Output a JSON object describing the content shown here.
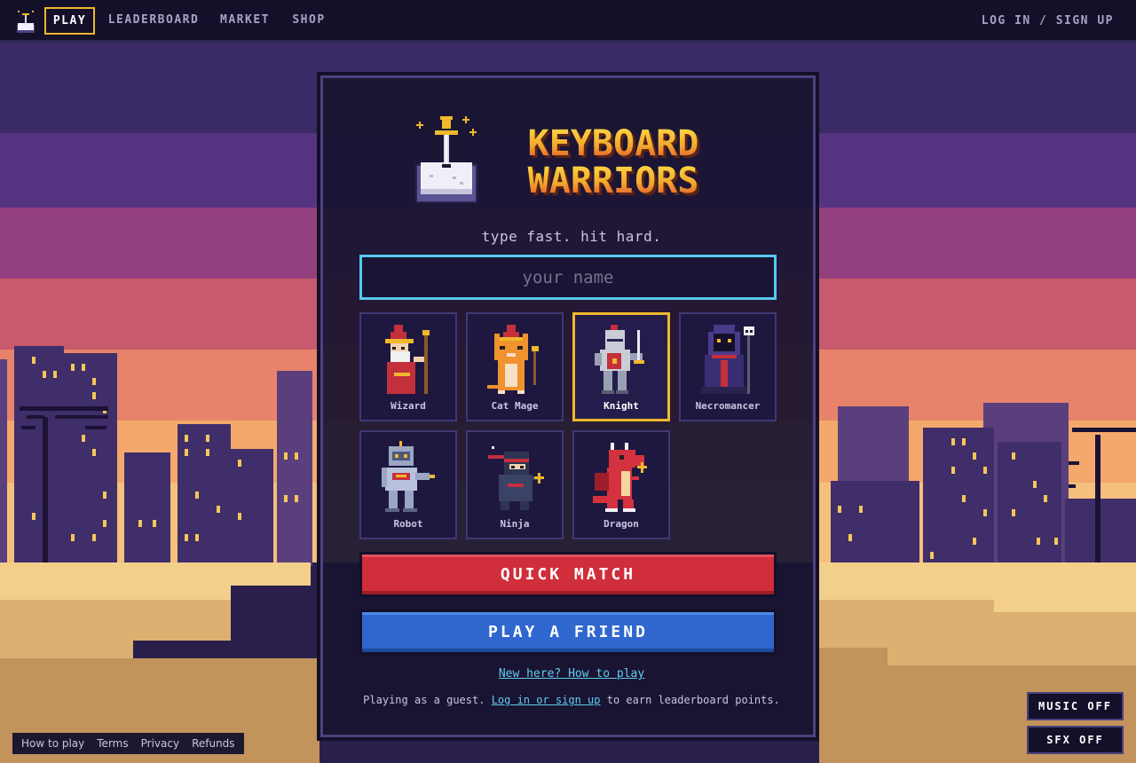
{
  "nav": {
    "items": [
      {
        "label": "PLAY",
        "active": true
      },
      {
        "label": "LEADERBOARD",
        "active": false
      },
      {
        "label": "MARKET",
        "active": false
      },
      {
        "label": "SHOP",
        "active": false
      }
    ],
    "login": "LOG IN / SIGN UP"
  },
  "hero": {
    "title_line1": "KEYBOARD",
    "title_line2": "WARRIORS",
    "tagline": "type fast. hit hard."
  },
  "name_input": {
    "placeholder": "your name",
    "value": ""
  },
  "characters": [
    {
      "label": "Wizard",
      "icon": "wizard-icon",
      "selected": false
    },
    {
      "label": "Cat Mage",
      "icon": "cat-mage-icon",
      "selected": false
    },
    {
      "label": "Knight",
      "icon": "knight-icon",
      "selected": true
    },
    {
      "label": "Necromancer",
      "icon": "necromancer-icon",
      "selected": false
    },
    {
      "label": "Robot",
      "icon": "robot-icon",
      "selected": false
    },
    {
      "label": "Ninja",
      "icon": "ninja-icon",
      "selected": false
    },
    {
      "label": "Dragon",
      "icon": "dragon-icon",
      "selected": false
    }
  ],
  "buttons": {
    "quick_match": "QUICK MATCH",
    "play_friend": "PLAY A FRIEND"
  },
  "links": {
    "how_to_play": "New here? How to play",
    "guest_prefix": "Playing as a guest.",
    "guest_link": "Log in or sign up",
    "guest_suffix": "to earn leaderboard points."
  },
  "footer": {
    "links": [
      "How to play",
      "Terms",
      "Privacy",
      "Refunds"
    ]
  },
  "toggles": {
    "music": "MUSIC OFF",
    "sfx": "SFX OFF"
  },
  "colors": {
    "accent_gold": "#f0b82c",
    "input_border": "#58c8ee",
    "quick_match": "#cf2e3a",
    "play_friend": "#2f67cf"
  }
}
